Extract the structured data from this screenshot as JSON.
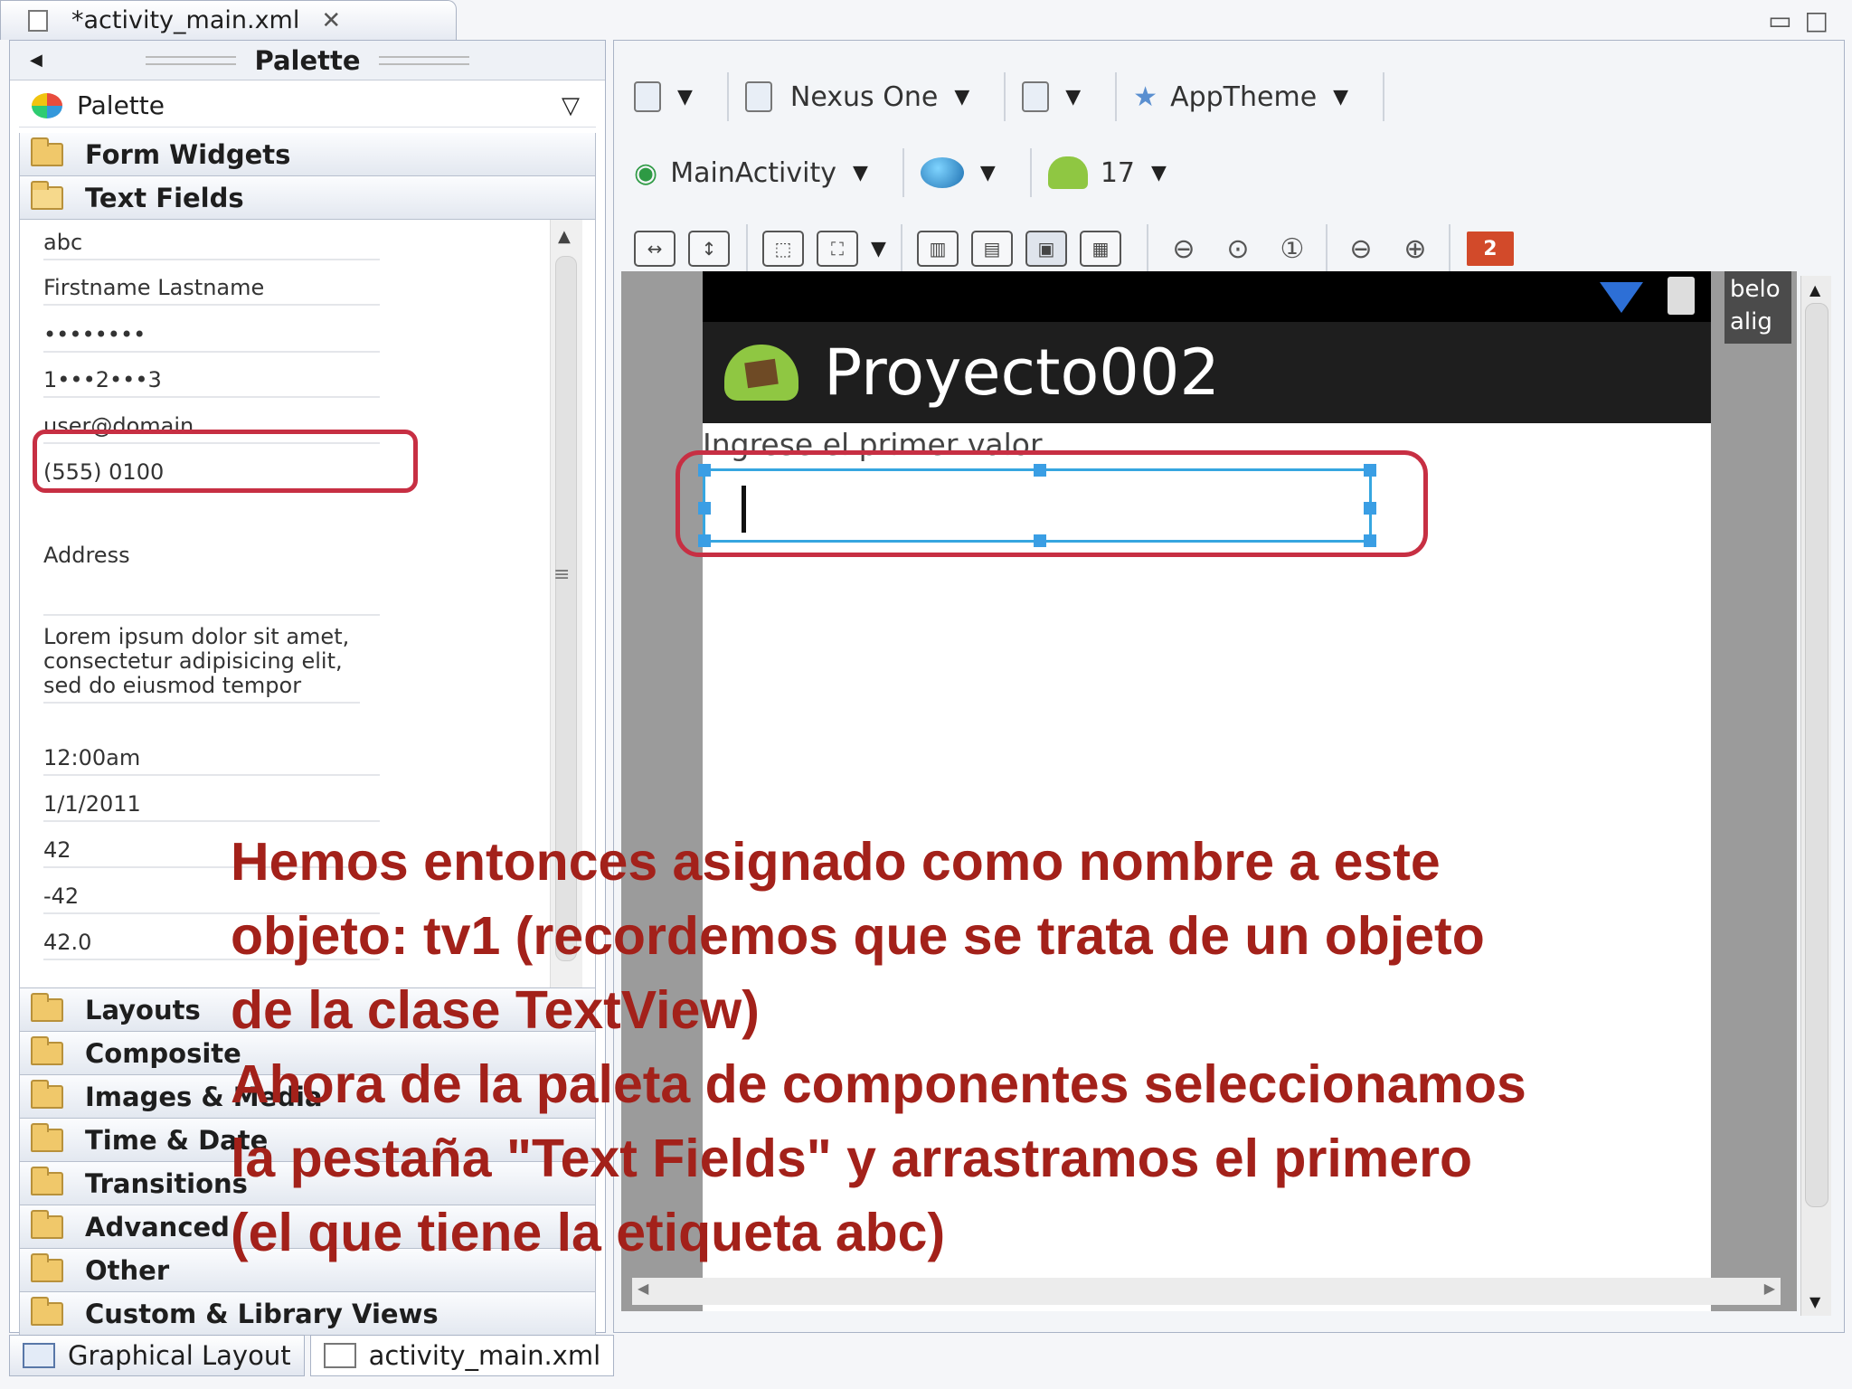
{
  "editor_tab": {
    "title": "*activity_main.xml"
  },
  "palette": {
    "header": "Palette",
    "dropdown_label": "Palette",
    "categories_top": [
      "Form Widgets",
      "Text Fields"
    ],
    "text_fields": [
      "abc",
      "Firstname Lastname",
      "••••••••",
      "1•••2•••3",
      "user@domain",
      "(555) 0100",
      "Address",
      "Lorem ipsum dolor sit amet, consectetur adipisicing elit, sed do eiusmod tempor",
      "12:00am",
      "1/1/2011",
      "42",
      "-42",
      "42.0"
    ],
    "categories_bottom": [
      "Layouts",
      "Composite",
      "Images & Media",
      "Time & Date",
      "Transitions",
      "Advanced",
      "Other",
      "Custom & Library Views"
    ]
  },
  "toolbar": {
    "device": "Nexus One",
    "theme": "AppTheme",
    "activity": "MainActivity",
    "api_level": "17",
    "warning_count": "2"
  },
  "device_preview": {
    "app_title": "Proyecto002",
    "label": "Ingrese el primer valor",
    "side_tooltip": "belo alig"
  },
  "bottom_tabs": [
    "Graphical Layout",
    "activity_main.xml"
  ],
  "caption": [
    "Hemos entonces asignado como nombre a este",
    "objeto: tv1 (recordemos que se trata de un objeto",
    "de la clase TextView)",
    "Ahora de la paleta de componentes seleccionamos",
    "la pestaña \"Text Fields\" y arrastramos el primero",
    "(el que tiene la etiqueta abc)"
  ]
}
